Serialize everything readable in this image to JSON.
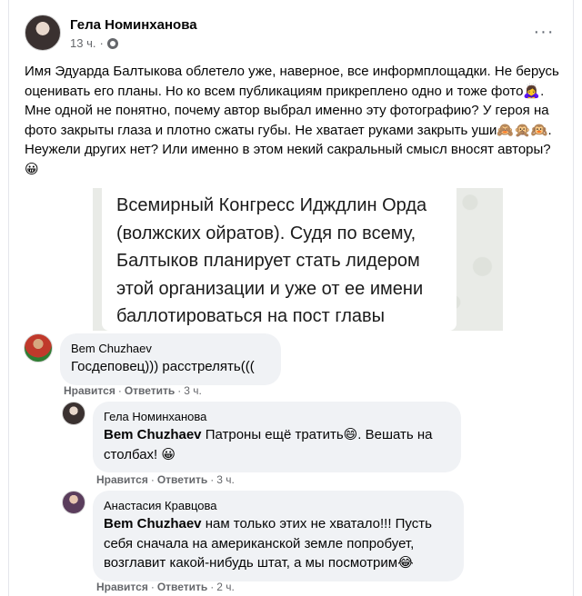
{
  "post": {
    "author": "Гела Номинханова",
    "time": "13 ч.",
    "privacy_icon": "globe-icon",
    "more": "···",
    "text": "Имя Эдуарда Балтыкова облетело уже, наверное, все информплощадки. Не берусь оценивать его планы. Но ко всем публикациям прикреплено одно и тоже фото🙇‍♀️. Мне одной не понятно, почему автор выбрал именно эту фотографию? У героя на фото закрыты глаза и плотно сжаты губы. Не хватает руками закрыть уши🙈🙊🙉. Неужели других нет? Или именно в этом некий сакральный смысл вносят авторы? 😀"
  },
  "shared_image": {
    "text": "Всемирный Конгресс Идждлин Орда (волжских ойратов). Судя по всему, Балтыков планирует стать лидером этой организации и уже от ее имени баллотироваться на пост главы Калмыкии."
  },
  "actions": {
    "like": "Нравится",
    "reply": "Ответить",
    "sep": "·"
  },
  "comments": [
    {
      "author": "Bem Chuzhaev",
      "mention": "",
      "text": "Госдеповец))) расстрелять(((",
      "time": "3 ч."
    },
    {
      "author": "Гела Номинханова",
      "mention": "Bem Chuzhaev",
      "text": " Патроны ещё тратить😄. Вешать на столбах! 😀",
      "time": "3 ч."
    },
    {
      "author": "Анастасия Кравцова",
      "mention": "Bem Chuzhaev",
      "text": " нам только этих не хватало!!! Пусть себя сначала на американской земле попробует, возглавит какой-нибудь штат, а мы посмотрим😂",
      "time": "2 ч."
    }
  ]
}
